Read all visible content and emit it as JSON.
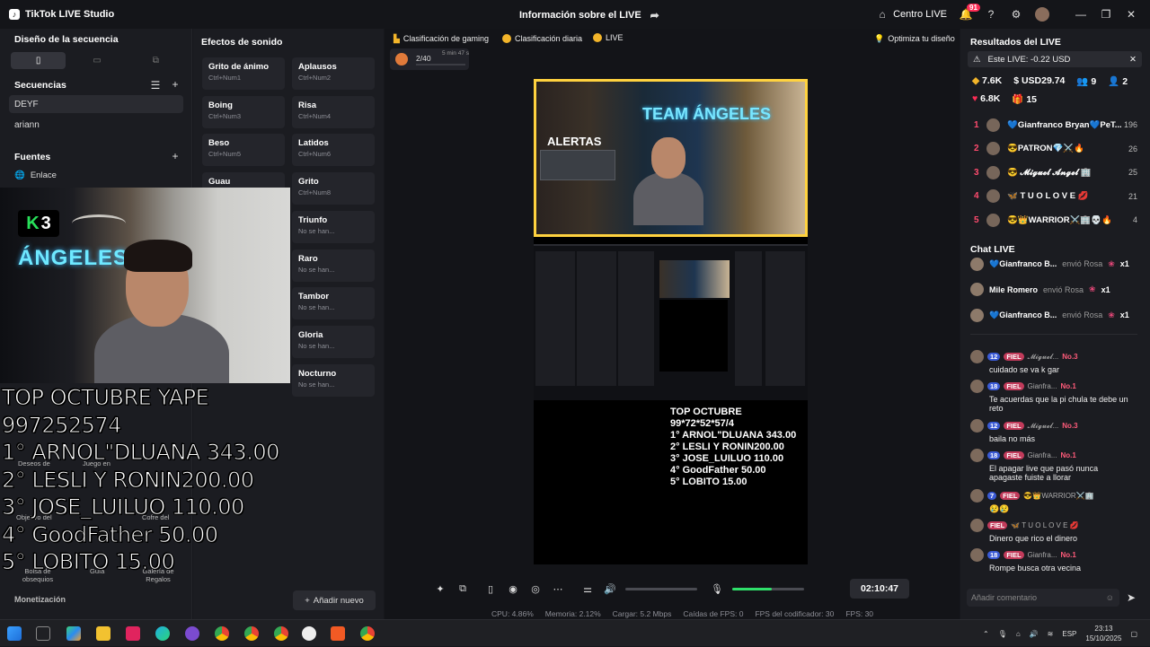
{
  "window": {
    "app_title": "TikTok LIVE Studio",
    "center_title": "Información sobre el LIVE",
    "centro_live": "Centro LIVE",
    "notif_count": "91"
  },
  "left": {
    "sequence_title": "Diseño de la secuencia",
    "sequences_title": "Secuencias",
    "sequences": [
      "DEYF",
      "ariann"
    ],
    "sources_title": "Fuentes",
    "source_item": "Enlace",
    "monetization": "Monetización",
    "ghost_labels": [
      "Deseos de",
      "Juego en",
      "Objetivo del",
      "Cofre del",
      "Bolsa de obsequios",
      "Guía",
      "Galería de Regalos"
    ]
  },
  "sounds": {
    "title": "Efectos de sonido",
    "items": [
      {
        "name": "Grito de ánimo",
        "key": "Ctrl+Num1"
      },
      {
        "name": "Aplausos",
        "key": "Ctrl+Num2"
      },
      {
        "name": "Boing",
        "key": "Ctrl+Num3"
      },
      {
        "name": "Risa",
        "key": "Ctrl+Num4"
      },
      {
        "name": "Beso",
        "key": "Ctrl+Num5"
      },
      {
        "name": "Latidos",
        "key": "Ctrl+Num6"
      },
      {
        "name": "Guau",
        "key": ""
      },
      {
        "name": "Grito",
        "key": "Ctrl+Num8"
      },
      {
        "name": "Triunfo",
        "key": "No se han..."
      },
      {
        "name": "Raro",
        "key": "No se han..."
      },
      {
        "name": "Tambor",
        "key": "No se han..."
      },
      {
        "name": "Gloria",
        "key": "No se han..."
      },
      {
        "name": "Nocturno",
        "key": "No se han..."
      }
    ],
    "add_new": "Añadir nuevo"
  },
  "camera": {
    "k_badge": "3",
    "neon_text": "ÁNGELES"
  },
  "overlay": {
    "lines": [
      "TOP OCTUBRE YAPE",
      "997252574",
      "1° ARNOL\"DLUANA 343.00",
      "2° LESLI Y RONIN200.00",
      "3° JOSE_LUILUO 110.00",
      "4° GoodFather 50.00",
      "5° LOBITO 15.00"
    ]
  },
  "center": {
    "chips": [
      "Clasificación de gaming",
      "Clasificación diaria",
      "LIVE"
    ],
    "optimize": "Optimiza tu diseño",
    "counter": "2/40",
    "counter_time": "5 min 47 s",
    "preview_alertas": "ALERTAS",
    "preview_team": "TEAM ÁNGELES",
    "preview_ranking": [
      "TOP OCTUBRE",
      "99*72*52*57/4",
      "1° ARNOL\"DLUANA 343.00",
      "2° LESLI Y RONIN200.00",
      "3° JOSE_LUILUO 110.00",
      "4° GoodFather 50.00",
      "5° LOBITO 15.00"
    ],
    "mic_level": 0.55,
    "volume_level": 0.0,
    "timer": "02:10:47",
    "stats": [
      "CPU: 4.86%",
      "Memoria: 2.12%",
      "Cargar: 5.2 Mbps",
      "Caídas de FPS: 0",
      "FPS del codificador: 30",
      "FPS: 30"
    ]
  },
  "right": {
    "results_title": "Resultados del LIVE",
    "banner": "Este LIVE: -0.22 USD",
    "metrics_row1": [
      "7.6K",
      "USD29.74",
      "9",
      "2"
    ],
    "metrics_row2": [
      "6.8K",
      "15"
    ],
    "ranking": [
      {
        "rank": "1",
        "name": "💙Gianfranco Bryan💙PeT...",
        "value": "196"
      },
      {
        "rank": "2",
        "name": "😎PATRON💎⚔️🔥",
        "value": "26"
      },
      {
        "rank": "3",
        "name": "😎 𝓜𝓲𝓰𝓾𝓮𝓵 𝓐𝓷𝓰𝓮𝓵 🏢",
        "value": "25"
      },
      {
        "rank": "4",
        "name": "🦋 T U O L O V E 💋",
        "value": "21"
      },
      {
        "rank": "5",
        "name": "😎👑WARRIOR⚔️🏢💀🔥",
        "value": "4"
      }
    ],
    "chat_title": "Chat LIVE",
    "gifts": [
      {
        "user": "💙Gianfranco B...",
        "action": "envió Rosa",
        "count": "x1"
      },
      {
        "user": "Mile Romero",
        "action": "envió Rosa",
        "count": "x1"
      },
      {
        "user": "💙Gianfranco B...",
        "action": "envió Rosa",
        "count": "x1"
      }
    ],
    "messages": [
      {
        "level": "12",
        "user": "𝓜𝓲𝓰𝓾𝓮𝓵...",
        "no": "No.3",
        "text": "cuidado se va k gar"
      },
      {
        "level": "18",
        "user": "Gianfra...",
        "no": "No.1",
        "text": "Te acuerdas que la pi chula te debe un reto"
      },
      {
        "level": "12",
        "user": "𝓜𝓲𝓰𝓾𝓮𝓵...",
        "no": "No.3",
        "text": "baila no más"
      },
      {
        "level": "18",
        "user": "Gianfra...",
        "no": "No.1",
        "text": "El apagar live que pasó nunca apagaste fuiste a llorar"
      },
      {
        "level": "7",
        "user": "😎👑WARRIOR⚔️🏢",
        "no": "",
        "text": "😢😢"
      },
      {
        "level": "",
        "user": "🦋 T U O L O V E 💋",
        "no": "",
        "text": "Dinero que rico el dinero"
      },
      {
        "level": "18",
        "user": "Gianfra...",
        "no": "No.1",
        "text": "Rompe busca otra vecina"
      }
    ],
    "fiel": "FIEL",
    "comment_placeholder": "Añadir comentario"
  },
  "taskbar": {
    "lang": "ESP",
    "time": "23:13",
    "date": "15/10/2025"
  }
}
